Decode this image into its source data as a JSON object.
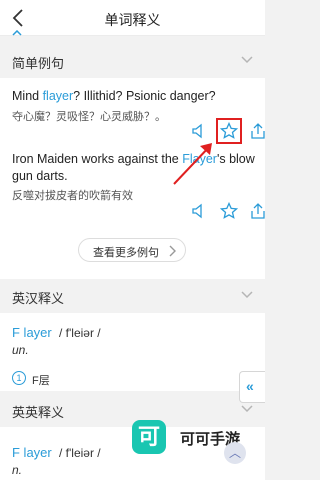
{
  "header": {
    "title": "单词释义",
    "back_icon": "back-arrow-icon"
  },
  "sections": {
    "examples": "简单例句",
    "en_cn": "英汉释义",
    "en_en": "英英释义"
  },
  "examples": [
    {
      "en_before": "Mind ",
      "en_hl": "flayer",
      "en_after": "? Illithid? Psionic danger?",
      "zh": "夺心魔？灵吸怪？心灵威胁？。"
    },
    {
      "en_before": "Iron Maiden works against the ",
      "en_hl": "Flayer",
      "en_after": "'s blow gun darts.",
      "zh": "反噬对拔皮者的吹箭有效"
    }
  ],
  "more_examples_label": "查看更多例句",
  "definition_en_cn": {
    "word": "F layer",
    "phonetic": "/ f'leiər /",
    "pos": "un.",
    "index": "1",
    "text": "F层"
  },
  "definition_en_en": {
    "word": "F layer",
    "phonetic": "/ f'leiər /",
    "pos": "n."
  },
  "side_tab_label": "«",
  "watermark": {
    "logo": "可",
    "text": "可可手游"
  },
  "colors": {
    "accent": "#2b9cd8",
    "highlight_box": "#e02020",
    "background": "#f2f2f2"
  }
}
